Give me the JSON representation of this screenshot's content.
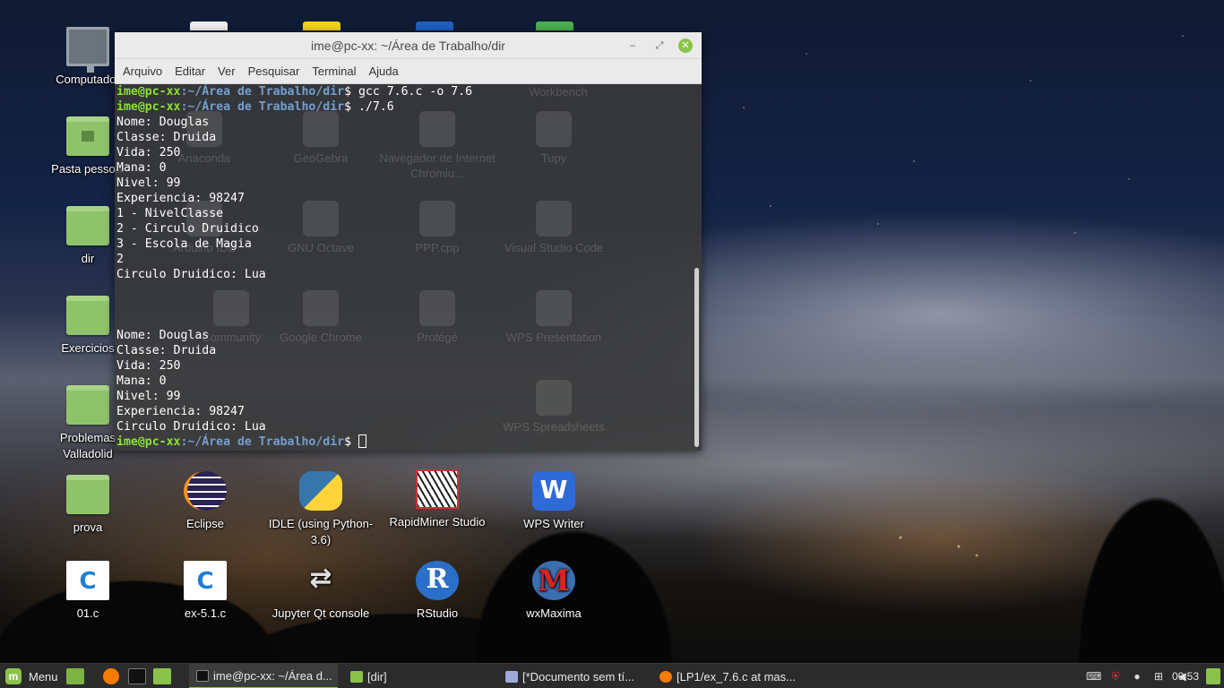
{
  "desktop": {
    "icons": [
      {
        "label": "Computador",
        "icon": "monitor-icon"
      },
      {
        "label": "Pasta pessoal",
        "icon": "home-folder-icon"
      },
      {
        "label": "dir",
        "icon": "folder-icon"
      },
      {
        "label": "Exercicios",
        "icon": "folder-icon"
      },
      {
        "label": "Problemas Valladolid",
        "icon": "folder-icon"
      },
      {
        "label": "prova",
        "icon": "folder-icon"
      },
      {
        "label": "01.c",
        "icon": "c-file-icon"
      },
      {
        "label": "Eclipse",
        "icon": "eclipse-icon"
      },
      {
        "label": "ex-5.1.c",
        "icon": "c-file-icon"
      },
      {
        "label": "IDLE (using Python-3.6)",
        "icon": "python-icon"
      },
      {
        "label": "Jupyter Qt console",
        "icon": "jupyter-icon"
      },
      {
        "label": "RapidMiner Studio",
        "icon": "rapidminer-icon"
      },
      {
        "label": "RStudio",
        "icon": "rstudio-icon"
      },
      {
        "label": "WPS Writer",
        "icon": "wps-writer-icon"
      },
      {
        "label": "wxMaxima",
        "icon": "wxmaxima-icon"
      }
    ],
    "behind_terminal": [
      "Workbench",
      "Anaconda",
      "GeoGebra",
      "Navegador de Internet Chromiu...",
      "Tupy",
      "Arduino IDE",
      "GNU Octave",
      "PPP.cpp",
      "Visual Studio Code",
      "Community",
      "Google Chrome",
      "Protégé",
      "WPS Presentation",
      "WPS Spreadsheets"
    ]
  },
  "terminal": {
    "title": "ime@pc-xx: ~/Área de Trabalho/dir",
    "menu": [
      "Arquivo",
      "Editar",
      "Ver",
      "Pesquisar",
      "Terminal",
      "Ajuda"
    ],
    "prompt_user": "ime@pc-xx",
    "prompt_path": ":~/Área de Trabalho/dir",
    "prompt_symbol": "$ ",
    "lines": [
      {
        "type": "prompt",
        "cmd": "gcc 7.6.c -o 7.6"
      },
      {
        "type": "prompt",
        "cmd": "./7.6"
      },
      {
        "type": "out",
        "text": "Nome: Douglas"
      },
      {
        "type": "out",
        "text": "Classe: Druida"
      },
      {
        "type": "out",
        "text": "Vida: 250"
      },
      {
        "type": "out",
        "text": "Mana: 0"
      },
      {
        "type": "out",
        "text": "Nivel: 99"
      },
      {
        "type": "out",
        "text": "Experiencia: 98247"
      },
      {
        "type": "out",
        "text": "1 - NivelClasse"
      },
      {
        "type": "out",
        "text": "2 - Circulo Druidico"
      },
      {
        "type": "out",
        "text": "3 - Escola de Magia"
      },
      {
        "type": "out",
        "text": "2"
      },
      {
        "type": "out",
        "text": "Circulo Druidico: Lua"
      },
      {
        "type": "out",
        "text": ""
      },
      {
        "type": "out",
        "text": ""
      },
      {
        "type": "out",
        "text": ""
      },
      {
        "type": "out",
        "text": "Nome: Douglas"
      },
      {
        "type": "out",
        "text": "Classe: Druida"
      },
      {
        "type": "out",
        "text": "Vida: 250"
      },
      {
        "type": "out",
        "text": "Mana: 0"
      },
      {
        "type": "out",
        "text": "Nivel: 99"
      },
      {
        "type": "out",
        "text": "Experiencia: 98247"
      },
      {
        "type": "out",
        "text": "Circulo Druidico: Lua"
      },
      {
        "type": "prompt",
        "cmd": "",
        "cursor": true
      }
    ]
  },
  "taskbar": {
    "menu_label": "Menu",
    "windows": [
      {
        "label": "ime@pc-xx: ~/Área d...",
        "icon": "terminal-icon",
        "active": true
      },
      {
        "label": "[dir]",
        "icon": "folder-icon",
        "active": false
      },
      {
        "label": "[*Documento sem tí...",
        "icon": "document-icon",
        "active": false
      },
      {
        "label": "[LP1/ex_7.6.c at mas...",
        "icon": "firefox-icon",
        "active": false
      }
    ],
    "clock": "09:53",
    "colors": {
      "accent": "#8bc34a",
      "panel": "#2b2b2b"
    }
  }
}
